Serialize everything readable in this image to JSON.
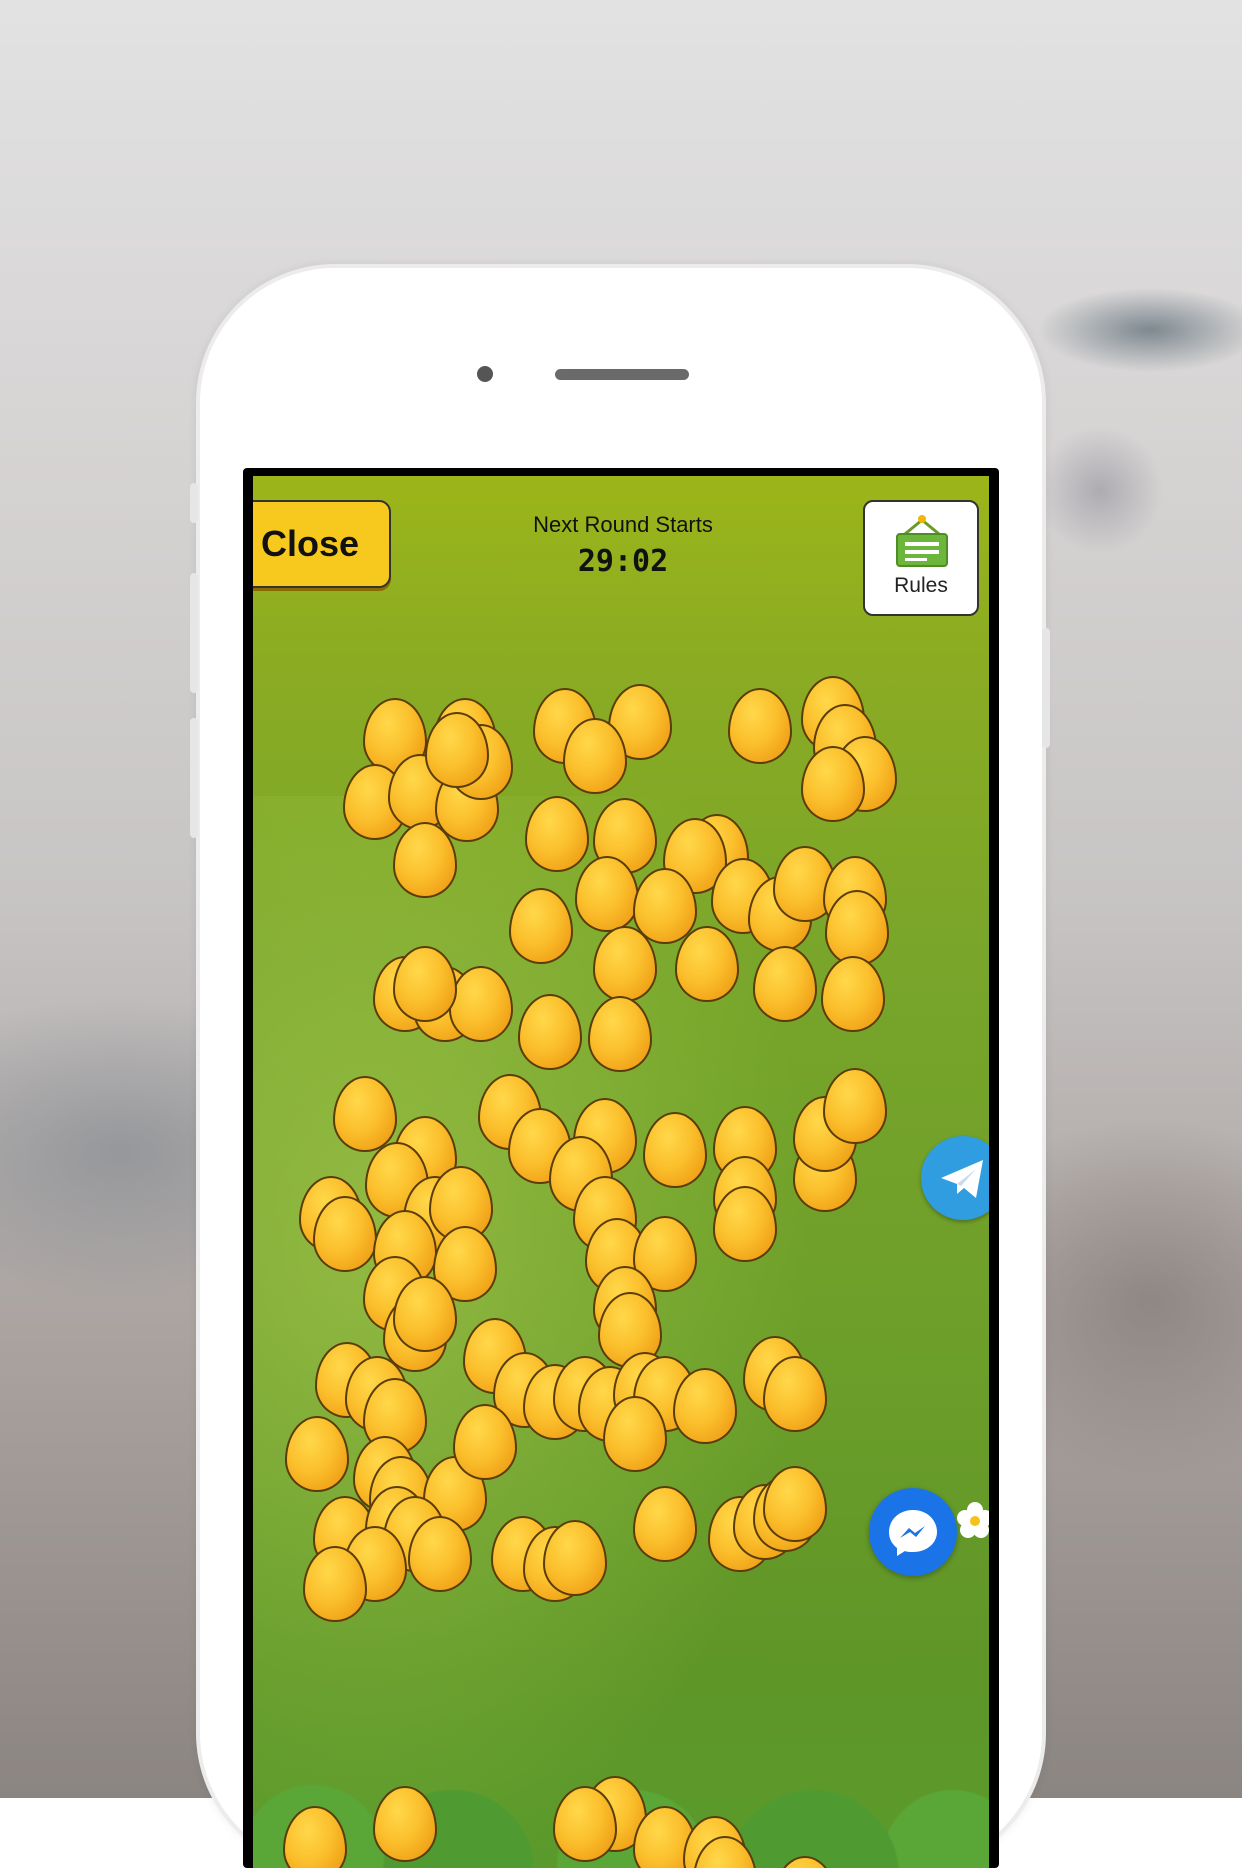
{
  "header": {
    "close_label": "Close",
    "timer_label": "Next Round Starts",
    "timer_value": "29:02",
    "rules_label": "Rules"
  },
  "icons": {
    "rules": "signboard-icon",
    "telegram": "telegram-icon",
    "messenger": "messenger-icon"
  },
  "colors": {
    "close_button": "#f7c91f",
    "egg": "#fbbf2c",
    "telegram": "#2f9de0",
    "messenger": "#1a74e8",
    "field": "#78a52a"
  },
  "eggs": {
    "count": 118
  }
}
